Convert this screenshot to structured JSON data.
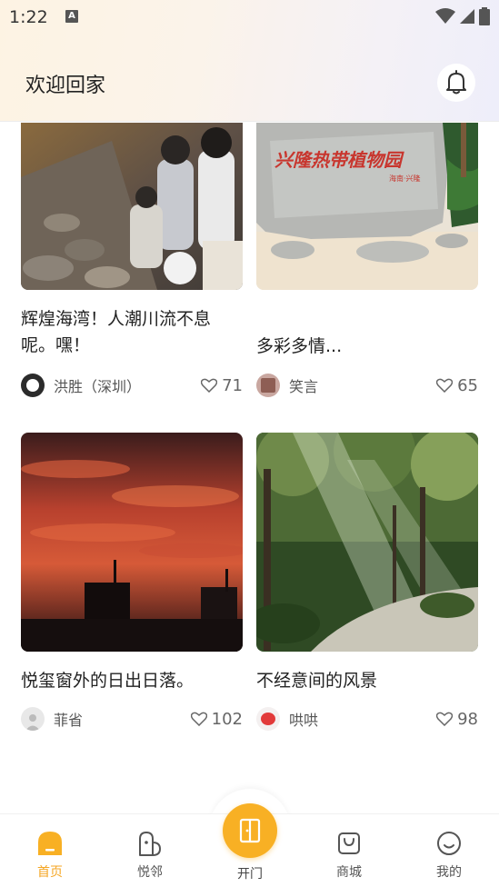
{
  "status_bar": {
    "time": "1:22",
    "notif_badge": "A"
  },
  "header": {
    "title": "欢迎回家"
  },
  "feed": {
    "cards": [
      {
        "title": "辉煌海湾！人潮川流不息呢。嘿！",
        "author": "洪胜（深圳）",
        "likes": "71"
      },
      {
        "title": "多彩多情...",
        "author": "笑言",
        "likes": "65",
        "sign_text": "兴隆热带植物园",
        "sign_sub": "海南·兴隆"
      },
      {
        "title": "悦玺窗外的日出日落。",
        "author": "菲省",
        "likes": "102"
      },
      {
        "title": "不经意间的风景",
        "author": "哄哄",
        "likes": "98"
      }
    ]
  },
  "tabbar": {
    "home": "首页",
    "neighbors": "悦邻",
    "open_door": "开门",
    "mall": "商城",
    "mine": "我的"
  },
  "colors": {
    "accent": "#f8b024",
    "active_tab": "#f5a623"
  }
}
